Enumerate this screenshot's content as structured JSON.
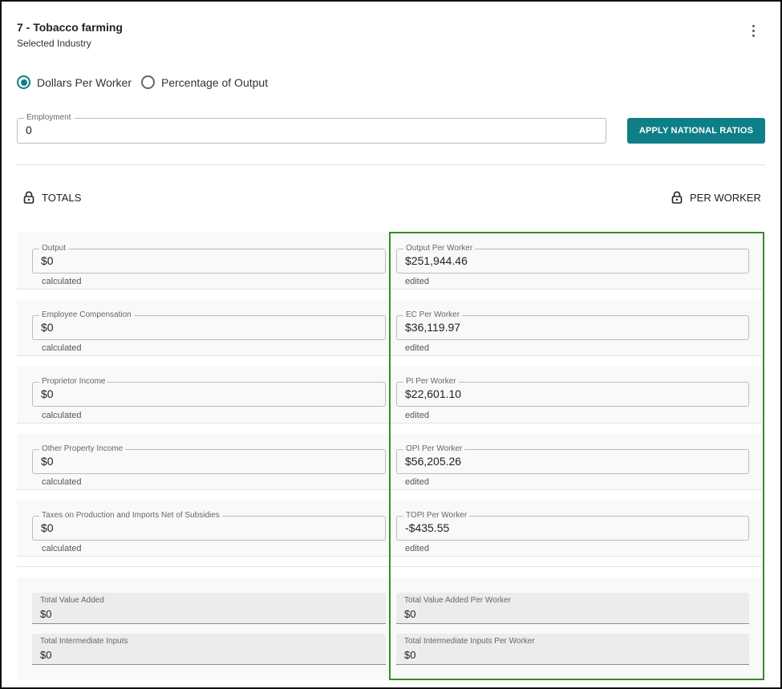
{
  "header": {
    "title": "7 - Tobacco farming",
    "subtitle": "Selected Industry",
    "menu_icon": "more-vertical-icon"
  },
  "mode": {
    "options": [
      {
        "label": "Dollars Per Worker",
        "selected": true
      },
      {
        "label": "Percentage of Output",
        "selected": false
      }
    ]
  },
  "employment": {
    "label": "Employment",
    "value": "0"
  },
  "apply_button": {
    "label": "APPLY NATIONAL RATIOS"
  },
  "locks": {
    "totals_label": "TOTALS",
    "per_worker_label": "PER WORKER",
    "icon": "lock-icon"
  },
  "rows": [
    {
      "total_label": "Output",
      "total_value": "$0",
      "total_status": "calculated",
      "worker_label": "Output Per Worker",
      "worker_value": "$251,944.46",
      "worker_status": "edited"
    },
    {
      "total_label": "Employee Compensation",
      "total_value": "$0",
      "total_status": "calculated",
      "worker_label": "EC Per Worker",
      "worker_value": "$36,119.97",
      "worker_status": "edited"
    },
    {
      "total_label": "Proprietor Income",
      "total_value": "$0",
      "total_status": "calculated",
      "worker_label": "PI Per Worker",
      "worker_value": "$22,601.10",
      "worker_status": "edited"
    },
    {
      "total_label": "Other Property Income",
      "total_value": "$0",
      "total_status": "calculated",
      "worker_label": "OPI Per Worker",
      "worker_value": "$56,205.26",
      "worker_status": "edited"
    },
    {
      "total_label": "Taxes on Production and Imports Net of Subsidies",
      "total_value": "$0",
      "total_status": "calculated",
      "worker_label": "TOPI Per Worker",
      "worker_value": "-$435.55",
      "worker_status": "edited"
    }
  ],
  "summary": [
    {
      "total_label": "Total Value Added",
      "total_value": "$0",
      "worker_label": "Total Value Added Per Worker",
      "worker_value": "$0"
    },
    {
      "total_label": "Total Intermediate Inputs",
      "total_value": "$0",
      "worker_label": "Total Intermediate Inputs Per Worker",
      "worker_value": "$0"
    }
  ],
  "colors": {
    "accent": "#0e7f87",
    "highlight_border": "#3a8a2a"
  }
}
